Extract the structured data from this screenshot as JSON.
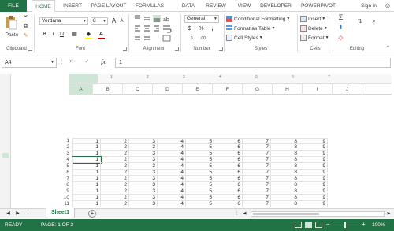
{
  "tabs": {
    "file": "FILE",
    "home": "HOME",
    "insert": "INSERT",
    "page_layout": "PAGE LAYOUT",
    "formulas": "FORMULAS",
    "data": "DATA",
    "review": "REVIEW",
    "view": "VIEW",
    "developer": "DEVELOPER",
    "powerpivot": "POWERPIVOT",
    "sign_in": "Sign in"
  },
  "clipboard": {
    "paste": "Paste",
    "label": "Clipboard"
  },
  "font": {
    "name": "Verdana",
    "size": "8",
    "bold": "B",
    "italic": "I",
    "underline": "U",
    "label": "Font"
  },
  "alignment": {
    "label": "Alignment"
  },
  "number": {
    "format": "General",
    "currency": "$",
    "percent": "%",
    "comma": ",",
    "label": "Number"
  },
  "styles": {
    "conditional": "Conditional Formatting",
    "table": "Format as Table",
    "cell_styles": "Cell Styles",
    "label": "Styles"
  },
  "cells": {
    "insert": "Insert",
    "delete": "Delete",
    "format": "Format",
    "label": "Cells"
  },
  "editing": {
    "sum": "Σ",
    "label": "Editing"
  },
  "formula_bar": {
    "name_box": "A4",
    "fx": "fx",
    "value": "1"
  },
  "columns": [
    "A",
    "B",
    "C",
    "D",
    "E",
    "F",
    "G",
    "H",
    "I",
    "J"
  ],
  "ruler": [
    "1",
    "2",
    "3",
    "4",
    "5",
    "6",
    "7"
  ],
  "rows": [
    {
      "n": "1",
      "cells": [
        "1",
        "2",
        "3",
        "4",
        "5",
        "6",
        "7",
        "8",
        "9"
      ]
    },
    {
      "n": "2",
      "cells": [
        "1",
        "2",
        "3",
        "4",
        "5",
        "6",
        "7",
        "8",
        "9"
      ]
    },
    {
      "n": "3",
      "cells": [
        "1",
        "2",
        "3",
        "4",
        "5",
        "6",
        "7",
        "8",
        "9"
      ]
    },
    {
      "n": "4",
      "cells": [
        "1",
        "2",
        "3",
        "4",
        "5",
        "6",
        "7",
        "8",
        "9"
      ]
    },
    {
      "n": "5",
      "cells": [
        "1",
        "2",
        "3",
        "4",
        "5",
        "6",
        "7",
        "8",
        "9"
      ]
    },
    {
      "n": "6",
      "cells": [
        "1",
        "2",
        "3",
        "4",
        "5",
        "6",
        "7",
        "8",
        "9"
      ]
    },
    {
      "n": "7",
      "cells": [
        "1",
        "2",
        "3",
        "4",
        "5",
        "6",
        "7",
        "8",
        "9"
      ]
    },
    {
      "n": "8",
      "cells": [
        "1",
        "2",
        "3",
        "4",
        "5",
        "6",
        "7",
        "8",
        "9"
      ]
    },
    {
      "n": "9",
      "cells": [
        "1",
        "2",
        "3",
        "4",
        "5",
        "6",
        "7",
        "8",
        "9"
      ]
    },
    {
      "n": "10",
      "cells": [
        "1",
        "2",
        "3",
        "4",
        "5",
        "6",
        "7",
        "8",
        "9"
      ]
    },
    {
      "n": "11",
      "cells": [
        "1",
        "2",
        "3",
        "4",
        "5",
        "6",
        "7",
        "8",
        "9"
      ]
    }
  ],
  "sheet_tab": "Sheet1",
  "add_sheet": "+",
  "status": {
    "ready": "READY",
    "page": "PAGE: 1 OF 2",
    "zoom": "100%",
    "zoom_minus": "−",
    "zoom_plus": "+"
  },
  "colors": {
    "accent": "#217346",
    "font_color": "#c00000",
    "fill_color": "#ffff00"
  }
}
